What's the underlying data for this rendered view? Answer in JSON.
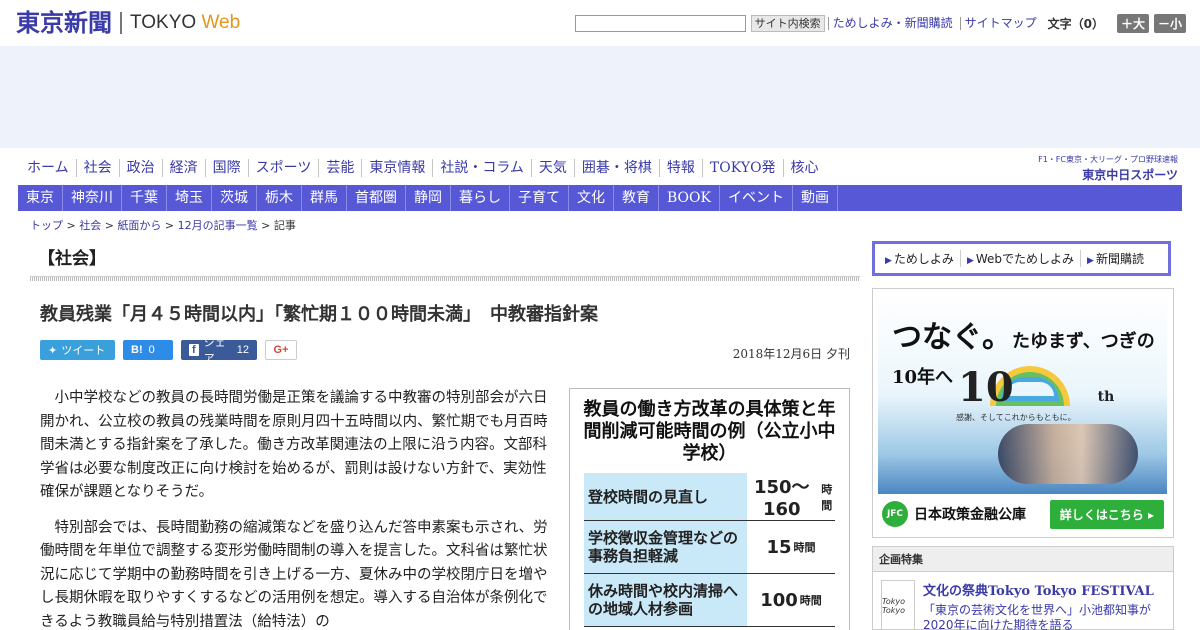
{
  "header": {
    "logo_jp": "東京新聞",
    "logo_en_main": "TOKYO ",
    "logo_en_web": "Web",
    "search_btn": "サイト内検索",
    "links": [
      "ためしよみ・新聞購読",
      "サイトマップ"
    ],
    "font_size_label": "文字（0）",
    "font_up": "＋大",
    "font_down": "－小"
  },
  "nav1": [
    "ホーム",
    "社会",
    "政治",
    "経済",
    "国際",
    "スポーツ",
    "芸能",
    "東京情報",
    "社説・コラム",
    "天気",
    "囲碁・将棋",
    "特報",
    "TOKYO発",
    "核心"
  ],
  "chunichi": {
    "small": "F1・FC東京・大リーグ・プロ野球速報",
    "big": "東京中日スポーツ"
  },
  "nav2": [
    "東京",
    "神奈川",
    "千葉",
    "埼玉",
    "茨城",
    "栃木",
    "群馬",
    "首都圏",
    "静岡",
    "暮らし",
    "子育て",
    "文化",
    "教育",
    "BOOK",
    "イベント",
    "動画"
  ],
  "breadcrumb": [
    "トップ",
    "社会",
    "紙面から",
    "12月の記事一覧",
    "記事"
  ],
  "section": "【社会】",
  "article": {
    "headline": "教員残業「月４５時間以内」「繁忙期１００時間未満」　中教審指針案",
    "date": "2018年12月6日 夕刊",
    "tweet": "ツイート",
    "hatena_count": "0",
    "share_label": "シェア",
    "share_count": "12",
    "gplus": "G+",
    "paragraphs": [
      "小中学校などの教員の長時間労働是正策を議論する中教審の特別部会が六日開かれ、公立校の教員の残業時間を原則月四十五時間以内、繁忙期でも月百時間未満とする指針案を了承した。働き方改革関連法の上限に沿う内容。文部科学省は必要な制度改正に向け検討を始めるが、罰則は設けない方針で、実効性確保が課題となりそうだ。",
      "特別部会では、長時間勤務の縮減策などを盛り込んだ答申素案も示され、労働時間を年単位で調整する変形労働時間制の導入を提言した。文科省は繁忙状況に応じて学期中の勤務時間を引き上げる一方、夏休み中の学校閉庁日を増やし長期休暇を取りやすくするなどの活用例を想定。導入する自治体が条例化できるよう教職員給与特別措置法（給特法）の"
    ]
  },
  "infographic": {
    "title": "教員の働き方改革の具体策と年間削減可能時間の例（公立小中学校）",
    "rows": [
      {
        "label": "登校時間の見直し",
        "value": "150～160",
        "unit": "時間"
      },
      {
        "label": "学校徴収金管理などの事務負担軽減",
        "value": "15",
        "unit": "時間"
      },
      {
        "label": "休み時間や校内清掃への地域人材参画",
        "value": "100",
        "unit": "時間"
      }
    ]
  },
  "sidebar": {
    "links": [
      "ためしよみ",
      "Webでためしよみ",
      "新聞購読"
    ],
    "ad": {
      "line1": "つなぐ。",
      "line1_small": "たゆまず、つぎの10年へ",
      "logo": "10",
      "logo_th": "th",
      "logo_sub": "感謝、そしてこれからもともに。",
      "badge": "JFC",
      "org": "日本政策金融公庫",
      "cta": "詳しくはこちら"
    },
    "feature": {
      "header": "企画特集",
      "thumb": "Tokyo Tokyo",
      "title": "文化の祭典Tokyo Tokyo FESTIVAL",
      "desc": "「東京の芸術文化を世界へ」小池都知事が2020年に向けた期待を語る"
    }
  }
}
